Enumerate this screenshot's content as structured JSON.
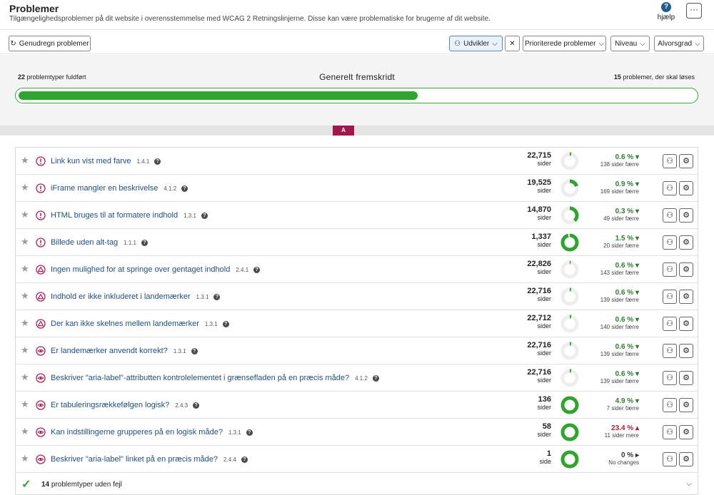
{
  "header": {
    "title": "Problemer",
    "subtitle": "Tilgængelighedsproblemer på dit website i overensstemmelse med WCAG 2 Retningslinjerne. Disse kan være problematiske for brugerne af dit website.",
    "help_label": "hjælp",
    "help_glyph": "?",
    "more_glyph": "···"
  },
  "toolbar": {
    "recalc_label": "Genudregn problemer",
    "recalc_glyph": "↻",
    "role_label": "Udvikler",
    "role_glyph": "⚇",
    "clear_glyph": "✕",
    "prioritized_label": "Prioriterede problemer",
    "level_label": "Niveau",
    "severity_label": "Alvorsgrad",
    "chevron": "⌵"
  },
  "progress": {
    "completed_count": "22",
    "completed_label": "problemtyper fuldført",
    "title": "Generelt fremskridt",
    "remaining_count": "15",
    "remaining_label": "problemer, der skal løses",
    "fill_fraction": 0.59
  },
  "level_tag": "A",
  "icons": {
    "star": "★",
    "assign": "⚇",
    "settings": "⚙",
    "question": "?"
  },
  "colors": {
    "good": "#2f7d32",
    "bad": "#b51d2c",
    "donut": "#2fa52f",
    "severity": "#b0205a",
    "link": "#1e4e8a"
  },
  "issues": [
    {
      "name": "Link kun vist med farve",
      "criterion": "1.4.1",
      "pages": "22,715",
      "unit": "sider",
      "pct": "0.6 %",
      "trend": "down",
      "delta": "138 sider færre",
      "severity": "error",
      "share": 0.03
    },
    {
      "name": "iFrame mangler en beskrivelse",
      "criterion": "4.1.2",
      "pages": "19,525",
      "unit": "sider",
      "pct": "0.9 %",
      "trend": "down",
      "delta": "169 sider færre",
      "severity": "error",
      "share": 0.2
    },
    {
      "name": "HTML bruges til at formatere indhold",
      "criterion": "1.3.1",
      "pages": "14,870",
      "unit": "sider",
      "pct": "0.3 %",
      "trend": "down",
      "delta": "49 sider færre",
      "severity": "error",
      "share": 0.38
    },
    {
      "name": "Billede uden alt-tag",
      "criterion": "1.1.1",
      "pages": "1,337",
      "unit": "sider",
      "pct": "1.5 %",
      "trend": "down",
      "delta": "20 sider færre",
      "severity": "error",
      "share": 0.96
    },
    {
      "name": "Ingen mulighed for at springe over gentaget indhold",
      "criterion": "2.4.1",
      "pages": "22,826",
      "unit": "sider",
      "pct": "0.6 %",
      "trend": "down",
      "delta": "143 sider færre",
      "severity": "warning",
      "share": 0.02
    },
    {
      "name": "Indhold er ikke inkluderet i landemærker",
      "criterion": "1.3.1",
      "pages": "22,716",
      "unit": "sider",
      "pct": "0.6 %",
      "trend": "down",
      "delta": "139 sider færre",
      "severity": "warning",
      "share": 0.03
    },
    {
      "name": "Der kan ikke skelnes mellem landemærker",
      "criterion": "1.3.1",
      "pages": "22,712",
      "unit": "sider",
      "pct": "0.6 %",
      "trend": "down",
      "delta": "140 sider færre",
      "severity": "warning",
      "share": 0.03
    },
    {
      "name": "Er landemærker anvendt korrekt?",
      "criterion": "1.3.1",
      "pages": "22,716",
      "unit": "sider",
      "pct": "0.6 %",
      "trend": "down",
      "delta": "139 sider færre",
      "severity": "review",
      "share": 0.03
    },
    {
      "name": "Beskriver \"aria-label\"-attributten kontrolelementet i grænsefladen på en præcis måde?",
      "criterion": "4.1.2",
      "pages": "22,716",
      "unit": "sider",
      "pct": "0.6 %",
      "trend": "down",
      "delta": "139 sider færre",
      "severity": "review",
      "share": 0.03
    },
    {
      "name": "Er tabuleringsrækkefølgen logisk?",
      "criterion": "2.4.3",
      "pages": "136",
      "unit": "sider",
      "pct": "4.9 %",
      "trend": "down",
      "delta": "7 sider færre",
      "severity": "review",
      "share": 1.0
    },
    {
      "name": "Kan indstillingerne grupperes på en logisk måde?",
      "criterion": "1.3.1",
      "pages": "58",
      "unit": "sider",
      "pct": "23.4 %",
      "trend": "up",
      "delta": "11 sider mere",
      "severity": "review",
      "share": 1.0
    },
    {
      "name": "Beskriver \"aria-label\" linket på en præcis måde?",
      "criterion": "2.4.4",
      "pages": "1",
      "unit": "side",
      "pct": "0 %",
      "trend": "flat",
      "delta": "No changes",
      "severity": "review",
      "share": 1.0
    }
  ],
  "footer": {
    "count": "14",
    "label": "problemtyper uden fejl",
    "check_glyph": "✓",
    "chevron": "⌵"
  }
}
